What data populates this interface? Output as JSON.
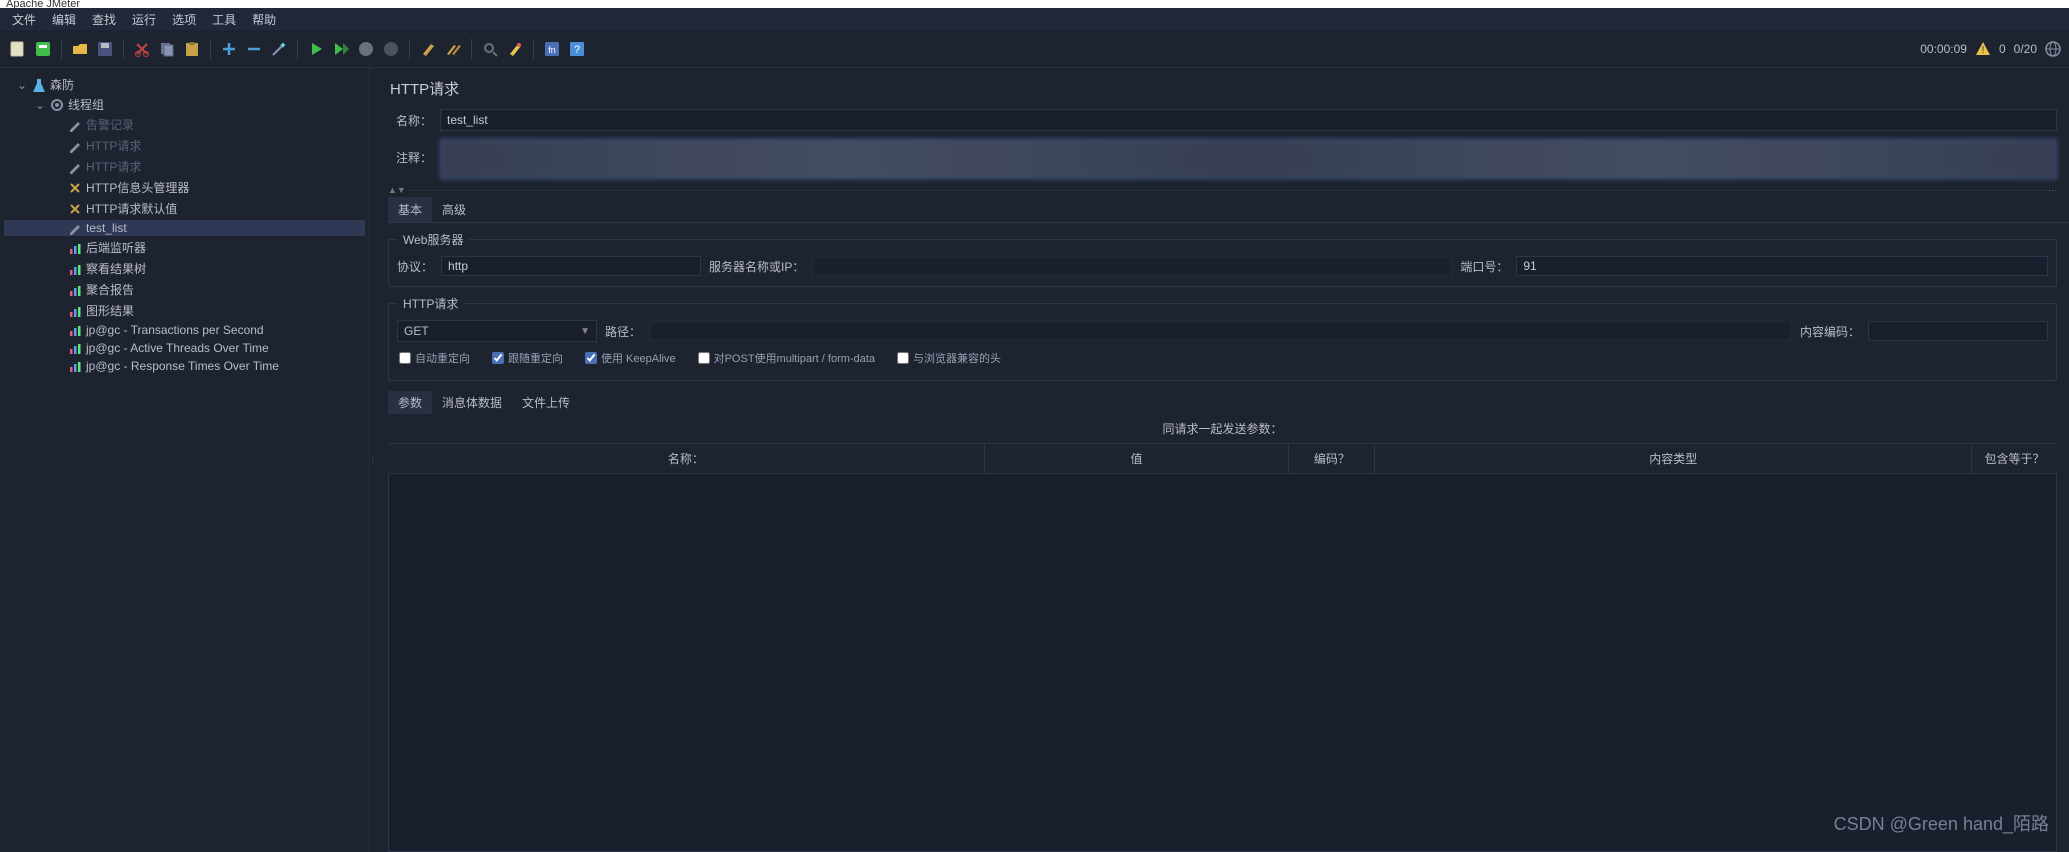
{
  "titlebar": "Apache JMeter",
  "menu": {
    "items": [
      "文件",
      "编辑",
      "查找",
      "运行",
      "选项",
      "工具",
      "帮助"
    ]
  },
  "toolbar": {
    "icons": [
      "file-new",
      "templates",
      "open",
      "save",
      "cut",
      "copy",
      "paste",
      "add",
      "remove",
      "wand",
      "run",
      "run-no-pause",
      "stop",
      "shutdown",
      "clear",
      "clear-all",
      "search",
      "reset-search",
      "fn",
      "help"
    ],
    "status": {
      "time": "00:00:09",
      "warn": "warn-icon",
      "count0": "0",
      "threads": "0/20"
    }
  },
  "tree": {
    "root": {
      "label": "森防",
      "expanded": true
    },
    "tg": {
      "label": "线程组",
      "expanded": true
    },
    "items": [
      {
        "label": "告警记录",
        "dim": true,
        "icon": "pen"
      },
      {
        "label": "HTTP请求",
        "dim": true,
        "icon": "pen"
      },
      {
        "label": "HTTP请求",
        "dim": true,
        "icon": "pen"
      },
      {
        "label": "HTTP信息头管理器",
        "icon": "tools"
      },
      {
        "label": "HTTP请求默认值",
        "icon": "tools"
      },
      {
        "label": "test_list",
        "icon": "pen",
        "selected": true
      },
      {
        "label": "后端监听器",
        "icon": "chart"
      },
      {
        "label": "察看结果树",
        "icon": "chart"
      },
      {
        "label": "聚合报告",
        "icon": "chart"
      },
      {
        "label": "图形结果",
        "icon": "chart"
      },
      {
        "label": "jp@gc - Transactions per Second",
        "icon": "chart"
      },
      {
        "label": "jp@gc - Active Threads Over Time",
        "icon": "chart"
      },
      {
        "label": "jp@gc - Response Times Over Time",
        "icon": "chart"
      }
    ]
  },
  "panel": {
    "title": "HTTP请求",
    "name_label": "名称：",
    "name_value": "test_list",
    "comment_label": "注释：",
    "tabs": {
      "basic": "基本",
      "advanced": "高级"
    },
    "web_server": {
      "legend": "Web服务器",
      "protocol_label": "协议：",
      "protocol_value": "http",
      "host_label": "服务器名称或IP：",
      "port_label": "端口号：",
      "port_value": "91"
    },
    "http_req": {
      "legend": "HTTP请求",
      "method": "GET",
      "path_label": "路径：",
      "encoding_label": "内容编码："
    },
    "checks": {
      "auto_redirect": "自动重定向",
      "follow_redirect": "跟随重定向",
      "keepalive": "使用 KeepAlive",
      "multipart": "对POST使用multipart / form-data",
      "browser_headers": "与浏览器兼容的头"
    },
    "param_tabs": {
      "params": "参数",
      "body": "消息体数据",
      "files": "文件上传"
    },
    "param_head": "同请求一起发送参数：",
    "cols": {
      "name": "名称：",
      "value": "值",
      "encode": "编码？",
      "ctype": "内容类型",
      "include": "包含等于？"
    }
  },
  "watermark": "CSDN @Green hand_陌路"
}
